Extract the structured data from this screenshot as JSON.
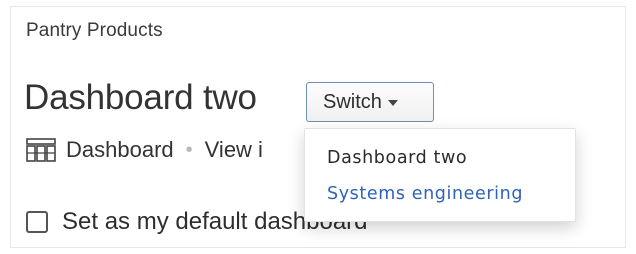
{
  "breadcrumb": "Pantry Products",
  "page_title": "Dashboard two",
  "switch_button": {
    "label": "Switch",
    "icon": "caret-down-icon"
  },
  "meta": {
    "icon": "dashboard-grid-icon",
    "type_label": "Dashboard",
    "separator": "•",
    "view_link_partial": "View i"
  },
  "default_checkbox": {
    "label": "Set as my default dashboard",
    "checked": false
  },
  "switch_menu": {
    "items": [
      {
        "label": "Dashboard two",
        "state": "current"
      },
      {
        "label": "Systems engineering",
        "state": "link"
      }
    ]
  },
  "colors": {
    "link": "#2f63b4",
    "button_border": "#6f8fb8",
    "text": "#333333"
  }
}
